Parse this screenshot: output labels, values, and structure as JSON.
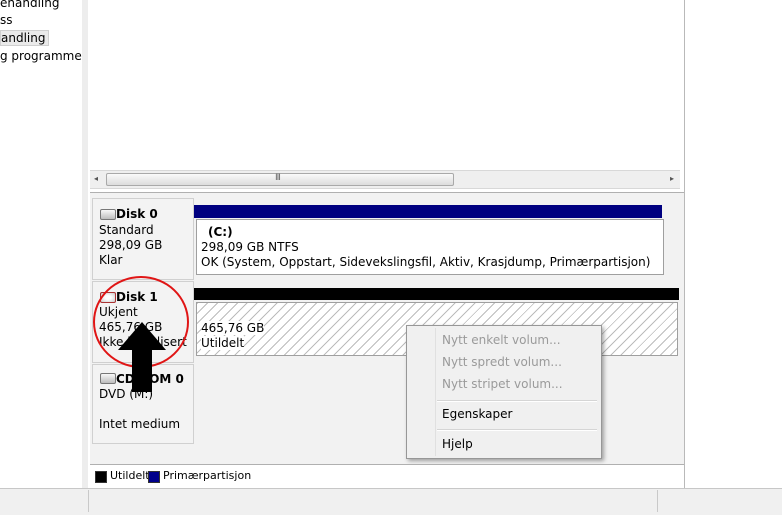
{
  "nav": {
    "items": [
      {
        "label": "ehandling"
      },
      {
        "label": "ss"
      },
      {
        "label": "andling"
      },
      {
        "label": "g programmer"
      }
    ]
  },
  "volume_list": {
    "scroll_left_glyph": "◂",
    "scroll_right_glyph": "▸",
    "grip_glyph": "III"
  },
  "disks": [
    {
      "title": "Disk 0",
      "type": "Standard",
      "size": "298,09 GB",
      "status": "Klar",
      "icon": "hard-disk-icon",
      "volume": {
        "name": "(C:)",
        "fs": "298,09 GB NTFS",
        "status": "OK (System, Oppstart, Sidevekslingsfil, Aktiv, Krasjdump, Primærpartisjon)"
      }
    },
    {
      "title": "Disk 1",
      "type": "Ukjent",
      "size": "465,76 GB",
      "status": "Ikke initialisert",
      "icon": "uninitialized-disk-icon",
      "volume": {
        "size": "465,76 GB",
        "status": "Utildelt"
      }
    },
    {
      "title": "CD-ROM 0",
      "type": "DVD (M:)",
      "status": "Intet medium",
      "icon": "cdrom-icon"
    }
  ],
  "context_menu": {
    "items": [
      {
        "label": "Nytt enkelt volum...",
        "enabled": false
      },
      {
        "label": "Nytt spredt volum...",
        "enabled": false
      },
      {
        "label": "Nytt stripet volum...",
        "enabled": false
      },
      {
        "label": "Egenskaper",
        "enabled": true
      },
      {
        "label": "Hjelp",
        "enabled": true
      }
    ]
  },
  "legend": {
    "items": [
      {
        "label": "Utildelt",
        "color": "#000000"
      },
      {
        "label": "Primærpartisjon",
        "color": "#00008b"
      }
    ]
  },
  "colors": {
    "primary_partition": "#000080",
    "unallocated": "#000000",
    "annotation_circle": "#e01515"
  }
}
